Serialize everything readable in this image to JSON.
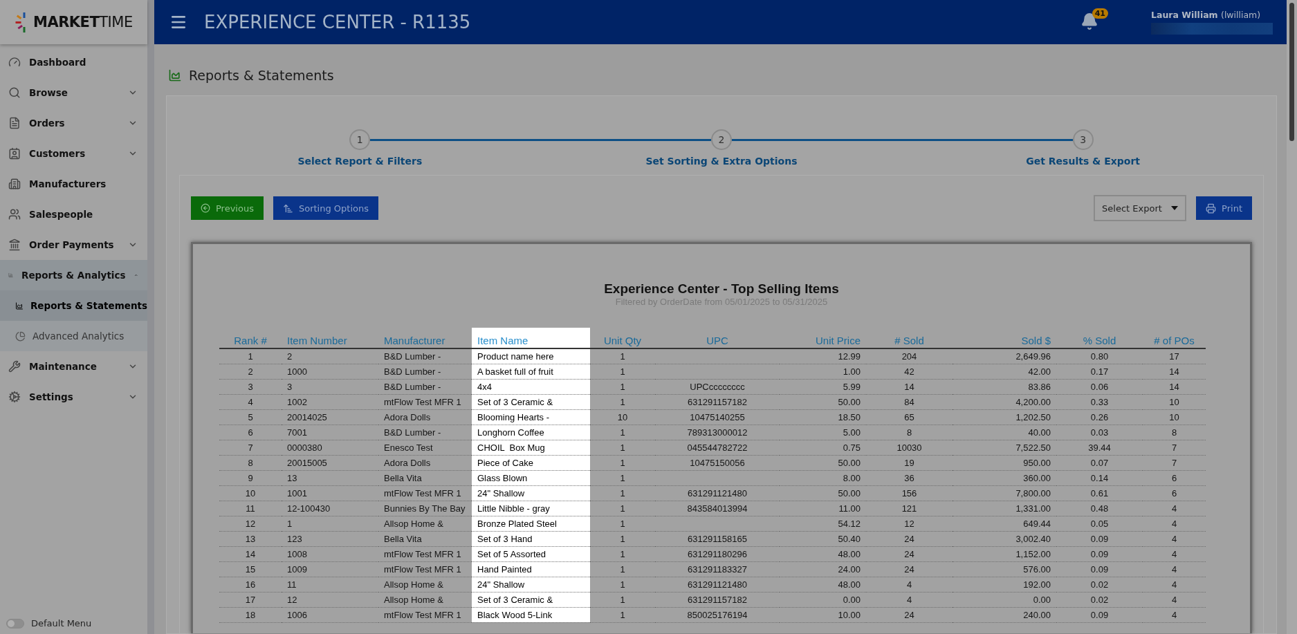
{
  "app": {
    "logo": "**MARKET**TIME",
    "title": "EXPERIENCE CENTER - R1135",
    "notifications": "41",
    "user": {
      "name": "Laura William",
      "login": "(lwilliam)"
    }
  },
  "sidebar": {
    "items": [
      {
        "kind": "link",
        "label": "Dashboard"
      },
      {
        "kind": "group",
        "label": "Browse",
        "expanded": false
      },
      {
        "kind": "group",
        "label": "Orders",
        "expanded": false
      },
      {
        "kind": "group",
        "label": "Customers",
        "expanded": false
      },
      {
        "kind": "link",
        "label": "Manufacturers"
      },
      {
        "kind": "link",
        "label": "Salespeople"
      },
      {
        "kind": "group",
        "label": "Order Payments",
        "expanded": false
      },
      {
        "kind": "group",
        "label": "Reports & Analytics",
        "expanded": true,
        "children": [
          {
            "label": "Reports & Statements",
            "selected": true
          },
          {
            "label": "Advanced Analytics",
            "selected": false
          }
        ]
      },
      {
        "kind": "group",
        "label": "Maintenance",
        "expanded": false
      },
      {
        "kind": "group",
        "label": "Settings",
        "expanded": false
      }
    ],
    "toggle": {
      "label": "Default Menu",
      "on": false
    }
  },
  "page": {
    "title": "Reports & Statements"
  },
  "steps": [
    {
      "number": "1",
      "label": "Select Report & Filters"
    },
    {
      "number": "2",
      "label": "Set Sorting & Extra Options"
    },
    {
      "number": "3",
      "label": "Get Results & Export"
    }
  ],
  "toolbar": {
    "left": [
      {
        "kind": "previous",
        "label": "Previous"
      },
      {
        "kind": "sorting",
        "label": "Sorting Options"
      }
    ],
    "export": {
      "placeholder": "Select Export"
    },
    "print": "Print"
  },
  "report": {
    "title": "Experience Center - Top Selling Items",
    "subtitle": "Filtered by OrderDate from 05/01/2025 to 05/31/2025",
    "columns": [
      {
        "label": "Rank #",
        "highlighted": false
      },
      {
        "label": "Item Number",
        "highlighted": false
      },
      {
        "label": "Manufacturer",
        "highlighted": false
      },
      {
        "label": "Item Name",
        "highlighted": true
      },
      {
        "label": "Unit Qty",
        "highlighted": false
      },
      {
        "label": "UPC",
        "highlighted": false
      },
      {
        "label": "Unit Price",
        "highlighted": false
      },
      {
        "label": "# Sold",
        "highlighted": false
      },
      {
        "label": "Sold $",
        "highlighted": false
      },
      {
        "label": "% Sold",
        "highlighted": false
      },
      {
        "label": "# of POs",
        "highlighted": false
      }
    ],
    "rows": [
      [
        "1",
        "2",
        "B&D Lumber -",
        "Product name here",
        "1",
        "",
        "12.99",
        "204",
        "2,649.96",
        "0.80",
        "17"
      ],
      [
        "2",
        "1000",
        "B&D Lumber -",
        "A basket full of fruit",
        "1",
        "",
        "1.00",
        "42",
        "42.00",
        "0.17",
        "14"
      ],
      [
        "3",
        "3",
        "B&D Lumber -",
        "4x4",
        "1",
        "UPCcccccccc",
        "5.99",
        "14",
        "83.86",
        "0.06",
        "14"
      ],
      [
        "4",
        "1002",
        "mtFlow Test MFR 1",
        "Set of 3 Ceramic &",
        "1",
        "631291157182",
        "50.00",
        "84",
        "4,200.00",
        "0.33",
        "10"
      ],
      [
        "5",
        "20014025",
        "Adora Dolls",
        "Blooming Hearts -",
        "10",
        "10475140255",
        "18.50",
        "65",
        "1,202.50",
        "0.26",
        "10"
      ],
      [
        "6",
        "7001",
        "B&D Lumber -",
        "Longhorn Coffee",
        "1",
        "789313000012",
        "5.00",
        "8",
        "40.00",
        "0.03",
        "8"
      ],
      [
        "7",
        "0000380",
        "Enesco Test",
        "CHOIL  Box Mug",
        "1",
        "045544782722",
        "0.75",
        "10030",
        "7,522.50",
        "39.44",
        "7"
      ],
      [
        "8",
        "20015005",
        "Adora Dolls",
        "Piece of Cake",
        "1",
        "10475150056",
        "50.00",
        "19",
        "950.00",
        "0.07",
        "7"
      ],
      [
        "9",
        "13",
        "Bella Vita",
        "Glass Blown",
        "1",
        "",
        "8.00",
        "36",
        "360.00",
        "0.14",
        "6"
      ],
      [
        "10",
        "1001",
        "mtFlow Test MFR 1",
        "24\" Shallow",
        "1",
        "631291121480",
        "50.00",
        "156",
        "7,800.00",
        "0.61",
        "6"
      ],
      [
        "11",
        "12-100430",
        "Bunnies By The Bay",
        "Little Nibble - gray",
        "1",
        "843584013994",
        "11.00",
        "121",
        "1,331.00",
        "0.48",
        "4"
      ],
      [
        "12",
        "1",
        "Allsop Home &",
        "Bronze Plated Steel",
        "1",
        "",
        "54.12",
        "12",
        "649.44",
        "0.05",
        "4"
      ],
      [
        "13",
        "123",
        "Bella Vita",
        "Set of 3 Hand",
        "1",
        "631291158165",
        "50.40",
        "24",
        "3,002.40",
        "0.09",
        "4"
      ],
      [
        "14",
        "1008",
        "mtFlow Test MFR 1",
        "Set of 5 Assorted",
        "1",
        "631291180296",
        "48.00",
        "24",
        "1,152.00",
        "0.09",
        "4"
      ],
      [
        "15",
        "1009",
        "mtFlow Test MFR 1",
        "Hand Painted",
        "1",
        "631291183327",
        "24.00",
        "24",
        "576.00",
        "0.09",
        "4"
      ],
      [
        "16",
        "11",
        "Allsop Home &",
        "24\" Shallow",
        "1",
        "631291121480",
        "48.00",
        "4",
        "192.00",
        "0.02",
        "4"
      ],
      [
        "17",
        "12",
        "Allsop Home &",
        "Set of 3 Ceramic &",
        "1",
        "631291157182",
        "0.00",
        "4",
        "0.00",
        "0.02",
        "4"
      ],
      [
        "18",
        "1006",
        "mtFlow Test MFR 1",
        "Black Wood 5-Link",
        "1",
        "850025176194",
        "10.00",
        "24",
        "240.00",
        "0.09",
        "4"
      ]
    ]
  }
}
